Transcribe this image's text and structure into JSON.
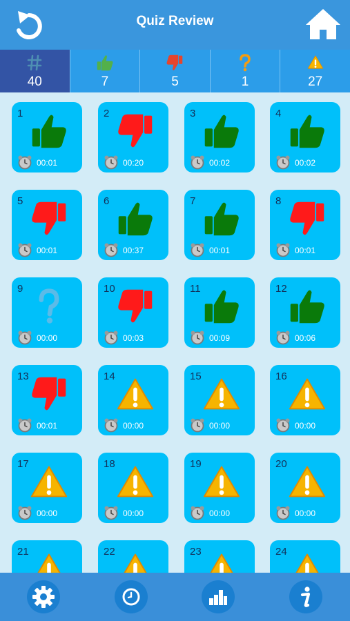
{
  "header": {
    "title": "Quiz Review",
    "back_icon": "undo-arrow-icon",
    "home_icon": "home-icon"
  },
  "stats": [
    {
      "icon": "hash-icon",
      "value": "40"
    },
    {
      "icon": "thumbs-up-icon",
      "value": "7"
    },
    {
      "icon": "thumbs-down-icon",
      "value": "5"
    },
    {
      "icon": "question-icon",
      "value": "1"
    },
    {
      "icon": "warning-icon",
      "value": "27"
    }
  ],
  "colors": {
    "correct": "#0a7a0a",
    "wrong": "#ff1a1a",
    "skipped": "#5bbbe8",
    "warning": "#f6b400",
    "tile": "#00c0fa"
  },
  "questions": [
    {
      "n": "1",
      "result": "correct",
      "time": "00:01"
    },
    {
      "n": "2",
      "result": "wrong",
      "time": "00:20"
    },
    {
      "n": "3",
      "result": "correct",
      "time": "00:02"
    },
    {
      "n": "4",
      "result": "correct",
      "time": "00:02"
    },
    {
      "n": "5",
      "result": "wrong",
      "time": "00:01"
    },
    {
      "n": "6",
      "result": "correct",
      "time": "00:37"
    },
    {
      "n": "7",
      "result": "correct",
      "time": "00:01"
    },
    {
      "n": "8",
      "result": "wrong",
      "time": "00:01"
    },
    {
      "n": "9",
      "result": "skipped",
      "time": "00:00"
    },
    {
      "n": "10",
      "result": "wrong",
      "time": "00:03"
    },
    {
      "n": "11",
      "result": "correct",
      "time": "00:09"
    },
    {
      "n": "12",
      "result": "correct",
      "time": "00:06"
    },
    {
      "n": "13",
      "result": "wrong",
      "time": "00:01"
    },
    {
      "n": "14",
      "result": "unanswered",
      "time": "00:00"
    },
    {
      "n": "15",
      "result": "unanswered",
      "time": "00:00"
    },
    {
      "n": "16",
      "result": "unanswered",
      "time": "00:00"
    },
    {
      "n": "17",
      "result": "unanswered",
      "time": "00:00"
    },
    {
      "n": "18",
      "result": "unanswered",
      "time": "00:00"
    },
    {
      "n": "19",
      "result": "unanswered",
      "time": "00:00"
    },
    {
      "n": "20",
      "result": "unanswered",
      "time": "00:00"
    },
    {
      "n": "21",
      "result": "unanswered",
      "time": ""
    },
    {
      "n": "22",
      "result": "unanswered",
      "time": ""
    },
    {
      "n": "23",
      "result": "unanswered",
      "time": ""
    },
    {
      "n": "24",
      "result": "unanswered",
      "time": ""
    }
  ],
  "footer": [
    {
      "icon": "gear-icon"
    },
    {
      "icon": "clock-icon"
    },
    {
      "icon": "bar-chart-icon"
    },
    {
      "icon": "info-icon"
    }
  ]
}
